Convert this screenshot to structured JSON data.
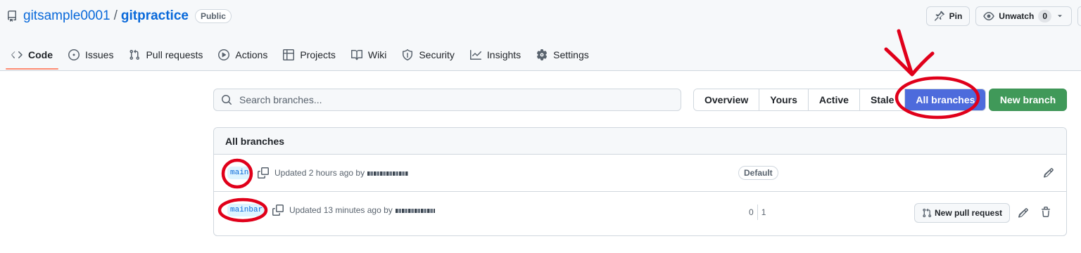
{
  "repo": {
    "owner": "gitsample0001",
    "separator": "/",
    "name": "gitpractice",
    "visibility": "Public"
  },
  "header_actions": {
    "pin_label": "Pin",
    "watch_label": "Unwatch",
    "watch_count": "0"
  },
  "nav": [
    {
      "label": "Code",
      "icon": "code-icon",
      "active": true
    },
    {
      "label": "Issues",
      "icon": "issue-icon"
    },
    {
      "label": "Pull requests",
      "icon": "pull-request-icon"
    },
    {
      "label": "Actions",
      "icon": "play-icon"
    },
    {
      "label": "Projects",
      "icon": "table-icon"
    },
    {
      "label": "Wiki",
      "icon": "book-icon"
    },
    {
      "label": "Security",
      "icon": "shield-icon"
    },
    {
      "label": "Insights",
      "icon": "graph-icon"
    },
    {
      "label": "Settings",
      "icon": "gear-icon"
    }
  ],
  "search": {
    "placeholder": "Search branches..."
  },
  "filters": {
    "overview": "Overview",
    "yours": "Yours",
    "active": "Active",
    "stale": "Stale",
    "all": "All branches",
    "selected": "All branches"
  },
  "new_branch_label": "New branch",
  "branches": {
    "heading": "All branches",
    "rows": [
      {
        "name": "main",
        "updated": "Updated 2 hours ago by",
        "badge": "Default"
      },
      {
        "name": "mainbar",
        "updated": "Updated 13 minutes ago by",
        "behind": "0",
        "ahead": "1",
        "pr_label": "New pull request"
      }
    ]
  },
  "colors": {
    "accent": "#0969da",
    "selected_filter": "#4d6bdc",
    "new_branch": "#1f883d",
    "annotation": "#e0001a"
  }
}
